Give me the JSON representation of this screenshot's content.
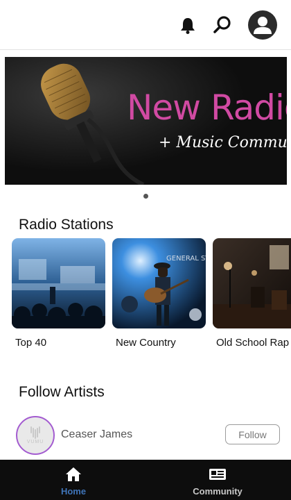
{
  "header": {
    "logo_icon": "waveform-logo-icon",
    "notifications_icon": "bell-icon",
    "search_icon": "search-icon",
    "profile_icon": "user-avatar-icon"
  },
  "banner": {
    "title": "New Radio",
    "subtitle": "+ Music Community",
    "title_color": "#d14aa3"
  },
  "radio_stations": {
    "title": "Radio Stations",
    "items": [
      {
        "label": "Top 40"
      },
      {
        "label": "New Country"
      },
      {
        "label": "Old School Rap"
      }
    ]
  },
  "follow_artists": {
    "title": "Follow Artists",
    "artists": [
      {
        "name": "Ceaser James",
        "follow_label": "Follow",
        "avatar_text": "VUMU"
      }
    ]
  },
  "bottom_nav": {
    "items": [
      {
        "label": "Home",
        "icon": "home-icon",
        "active": true
      },
      {
        "label": "Community",
        "icon": "community-icon",
        "active": false
      }
    ],
    "active_color": "#3f74b8",
    "inactive_color": "#c9c9c9"
  }
}
